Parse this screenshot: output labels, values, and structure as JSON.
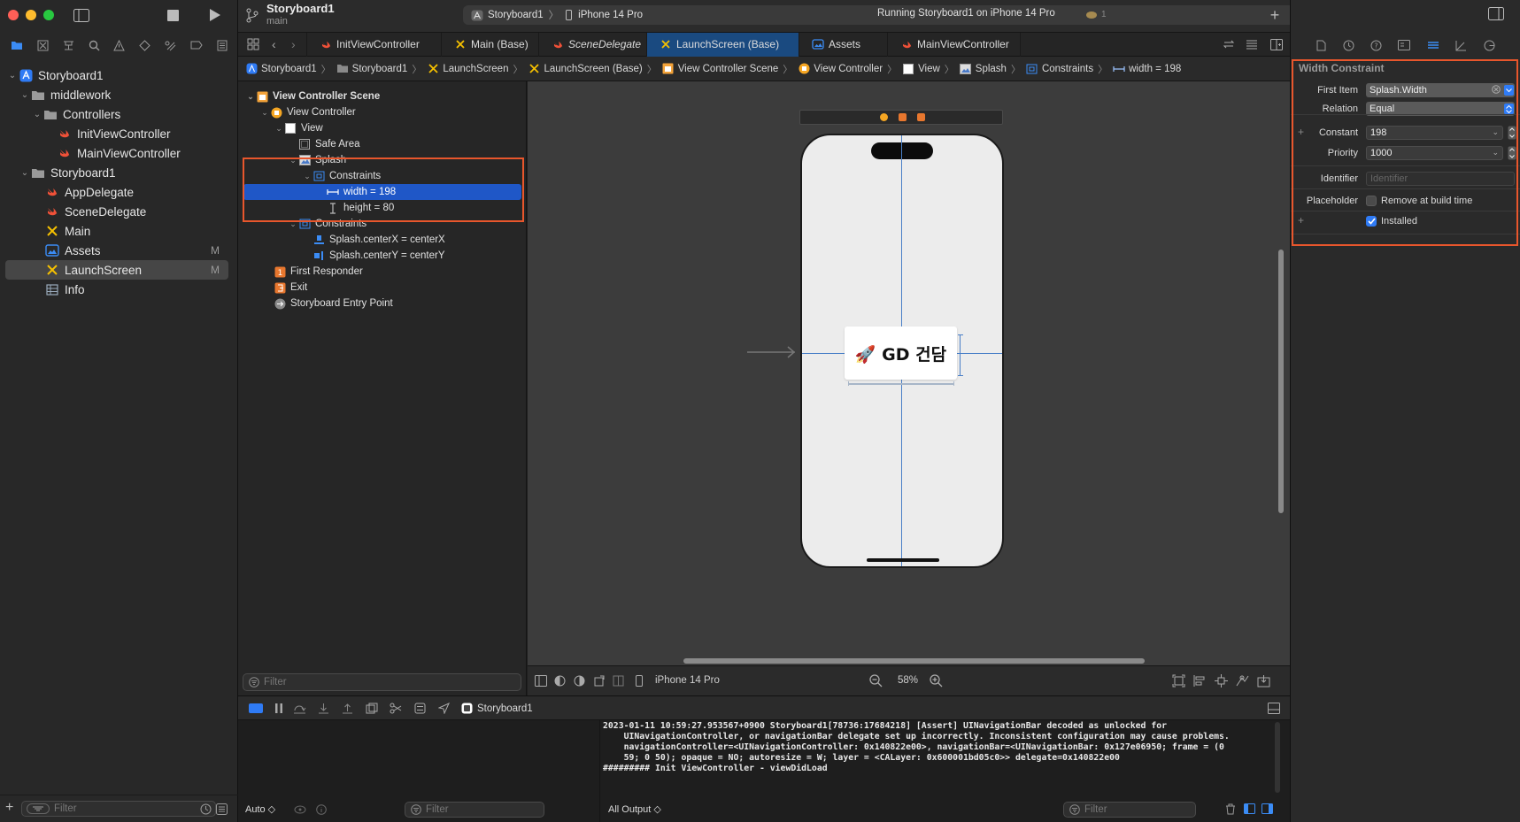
{
  "window": {
    "project_title": "Storyboard1",
    "branch": "main",
    "scheme": "Storyboard1",
    "device": "iPhone 14 Pro",
    "status": "Running Storyboard1 on iPhone 14 Pro",
    "warnings_count": "1"
  },
  "navigator": {
    "items": [
      {
        "label": "Storyboard1",
        "icon": "project-icon",
        "badge": ""
      },
      {
        "label": "middlework",
        "icon": "folder-icon",
        "badge": ""
      },
      {
        "label": "Controllers",
        "icon": "folder-icon",
        "badge": ""
      },
      {
        "label": "InitViewController",
        "icon": "swift-file-icon",
        "badge": ""
      },
      {
        "label": "MainViewController",
        "icon": "swift-file-icon",
        "badge": ""
      },
      {
        "label": "Storyboard1",
        "icon": "folder-icon",
        "badge": ""
      },
      {
        "label": "AppDelegate",
        "icon": "swift-file-icon",
        "badge": ""
      },
      {
        "label": "SceneDelegate",
        "icon": "swift-file-icon",
        "badge": ""
      },
      {
        "label": "Main",
        "icon": "storyboard-icon",
        "badge": ""
      },
      {
        "label": "Assets",
        "icon": "asset-catalog-icon",
        "badge": "M"
      },
      {
        "label": "LaunchScreen",
        "icon": "storyboard-icon",
        "badge": "M"
      },
      {
        "label": "Info",
        "icon": "plist-icon",
        "badge": ""
      }
    ],
    "filter_placeholder": "Filter"
  },
  "tabs": [
    {
      "label": "InitViewController",
      "icon": "swift-file-icon"
    },
    {
      "label": "Main (Base)",
      "icon": "storyboard-icon"
    },
    {
      "label": "SceneDelegate",
      "icon": "swift-file-icon"
    },
    {
      "label": "LaunchScreen (Base)",
      "icon": "storyboard-icon"
    },
    {
      "label": "Assets",
      "icon": "asset-catalog-icon"
    },
    {
      "label": "MainViewController",
      "icon": "swift-file-icon"
    }
  ],
  "breadcrumb": [
    "Storyboard1",
    "Storyboard1",
    "LaunchScreen",
    "LaunchScreen (Base)",
    "View Controller Scene",
    "View Controller",
    "View",
    "Splash",
    "Constraints",
    "width = 198"
  ],
  "outline": {
    "items": [
      {
        "label": "View Controller Scene"
      },
      {
        "label": "View Controller"
      },
      {
        "label": "View"
      },
      {
        "label": "Safe Area"
      },
      {
        "label": "Splash"
      },
      {
        "label": "Constraints"
      },
      {
        "label": "width = 198"
      },
      {
        "label": "height = 80"
      },
      {
        "label": "Constraints"
      },
      {
        "label": "Splash.centerX = centerX"
      },
      {
        "label": "Splash.centerY = centerY"
      },
      {
        "label": "First Responder"
      },
      {
        "label": "Exit"
      },
      {
        "label": "Storyboard Entry Point"
      }
    ],
    "filter_placeholder": "Filter"
  },
  "canvas": {
    "splash_text": "🚀 GD 건담",
    "device": "iPhone 14 Pro",
    "zoom": "58%"
  },
  "debug": {
    "target": "Storyboard1",
    "auto_label": "Auto ◇",
    "vars_filter_placeholder": "Filter",
    "output_selector": "All Output ◇",
    "console_filter_placeholder": "Filter",
    "console_lines": [
      "2023-01-11 10:59:27.953567+0900 Storyboard1[78736:17684218] [Assert] UINavigationBar decoded as unlocked for",
      "    UINavigationController, or navigationBar delegate set up incorrectly. Inconsistent configuration may cause problems.",
      "    navigationController=<UINavigationController: 0x140822e00>, navigationBar=<UINavigationBar: 0x127e06950; frame = (0",
      "    59; 0 50); opaque = NO; autoresize = W; layer = <CALayer: 0x600001bd05c0>> delegate=0x140822e00",
      "######### Init ViewController - viewDidLoad"
    ]
  },
  "inspector": {
    "section_title": "Width Constraint",
    "first_item_label": "First Item",
    "first_item_value": "Splash.Width",
    "relation_label": "Relation",
    "relation_value": "Equal",
    "constant_label": "Constant",
    "constant_value": "198",
    "priority_label": "Priority",
    "priority_value": "1000",
    "identifier_label": "Identifier",
    "identifier_placeholder": "Identifier",
    "placeholder_label": "Placeholder",
    "placeholder_option": "Remove at build time",
    "installed_label": "Installed",
    "installed": true
  },
  "colors": {
    "selection_blue": "#1f57c7",
    "highlight_red": "#e8562c",
    "swift_orange": "#f05138",
    "storyboard_yellow": "#f5c000"
  }
}
